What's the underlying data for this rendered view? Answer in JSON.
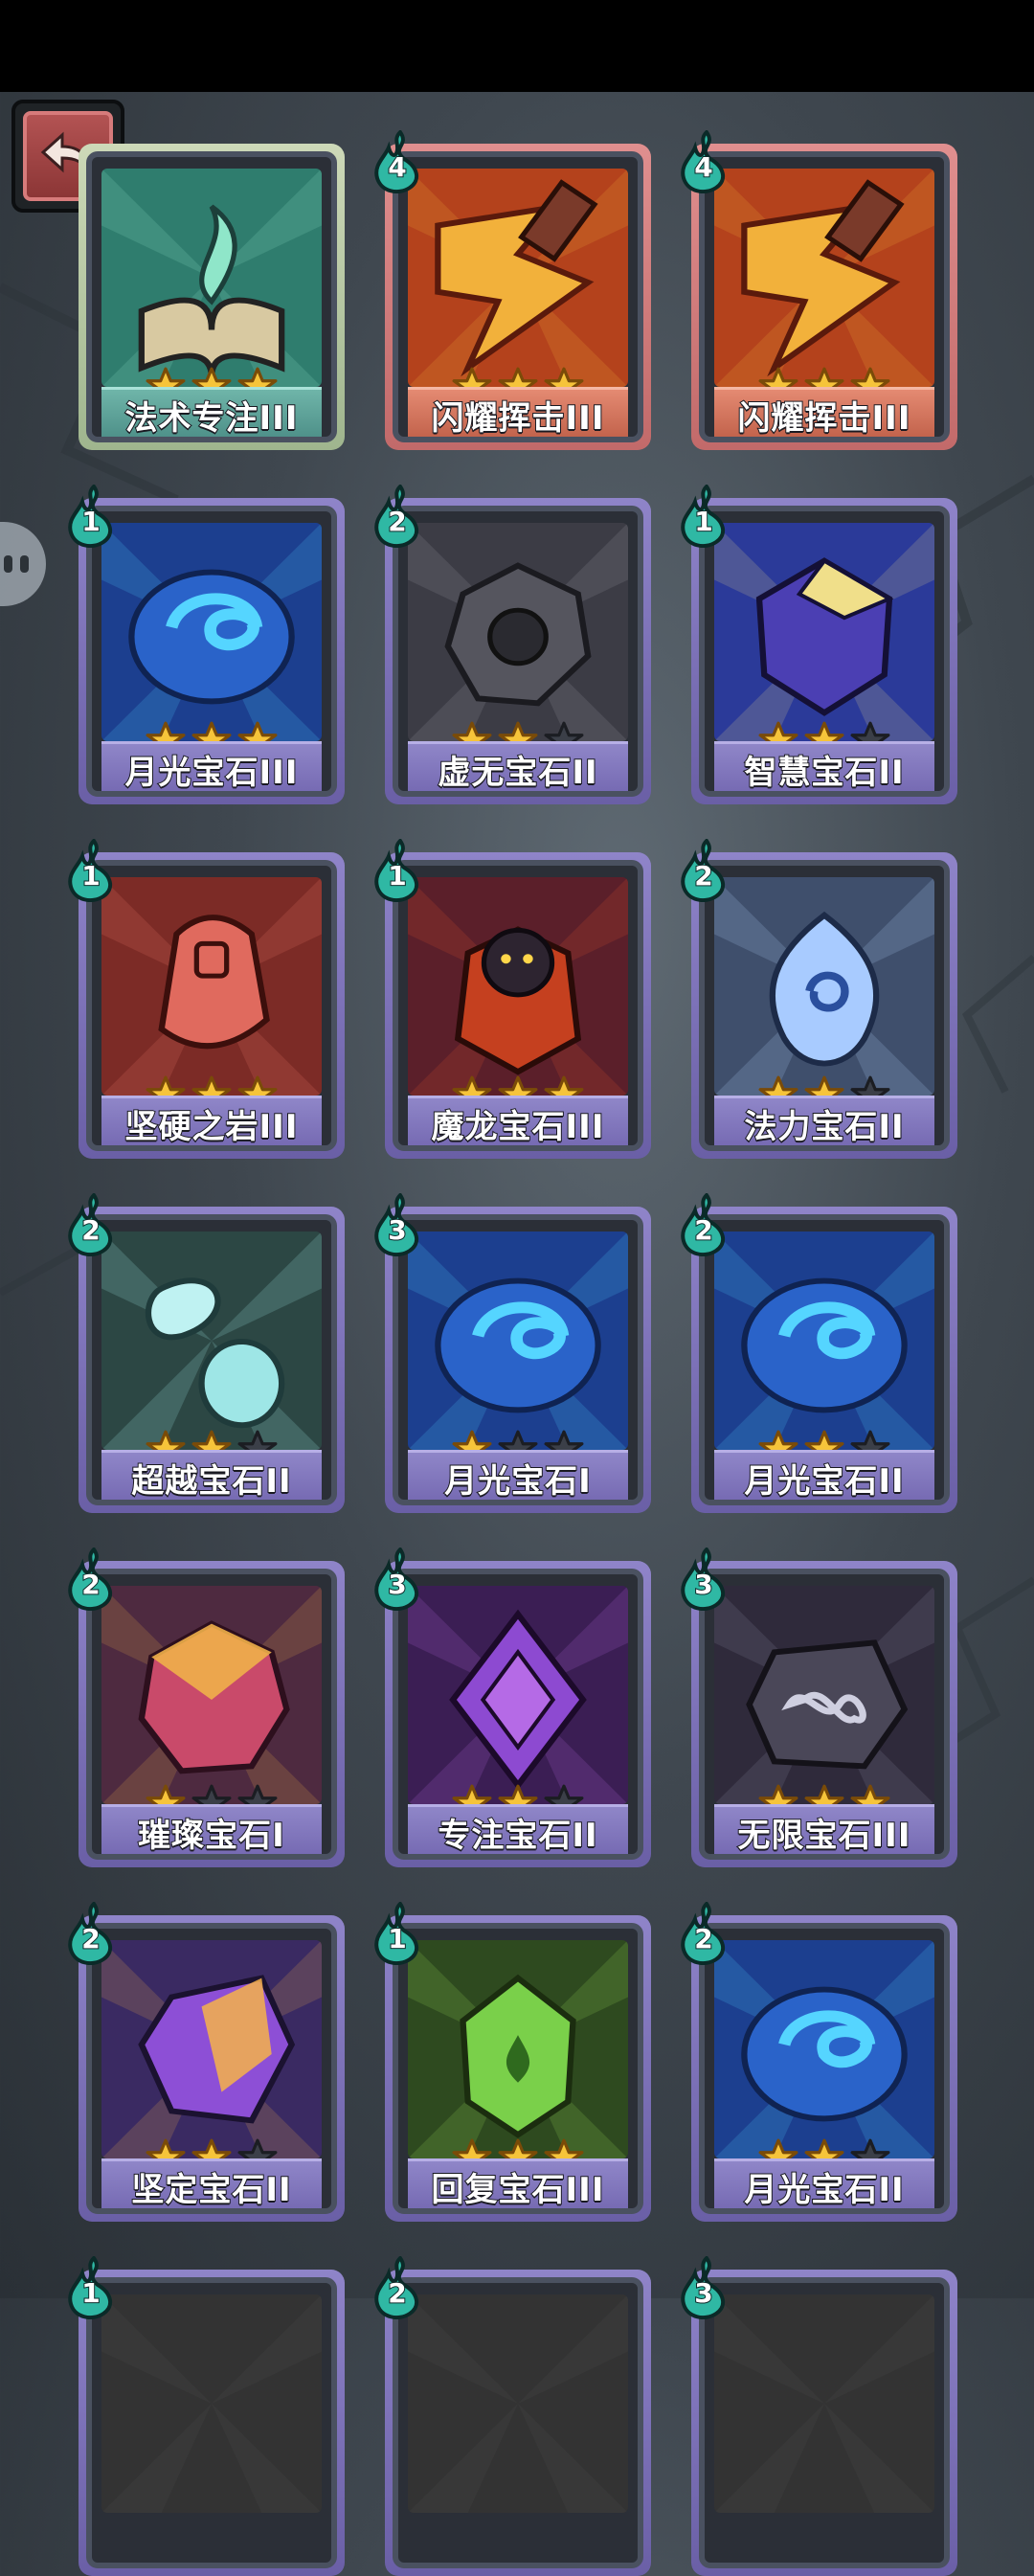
{
  "ui": {
    "back_icon": "back-arrow-icon"
  },
  "cards": [
    {
      "name": "法术专注III",
      "stars": 3,
      "cost": null,
      "frame": "green",
      "art": "book",
      "colors": [
        "#2f7d6e",
        "#8fe6c9"
      ]
    },
    {
      "name": "闪耀挥击III",
      "stars": 3,
      "cost": "4",
      "frame": "red",
      "art": "slash",
      "colors": [
        "#b4421c",
        "#f2b13b"
      ]
    },
    {
      "name": "闪耀挥击III",
      "stars": 3,
      "cost": "4",
      "frame": "red",
      "art": "slash",
      "colors": [
        "#b4421c",
        "#f2b13b"
      ]
    },
    {
      "name": "月光宝石III",
      "stars": 3,
      "cost": "1",
      "frame": "gem",
      "art": "moon",
      "colors": [
        "#1c3f8f",
        "#55d5ff"
      ]
    },
    {
      "name": "虚无宝石II",
      "stars": 2,
      "cost": "2",
      "frame": "gem",
      "art": "void",
      "colors": [
        "#3c3c45",
        "#9a9aa6"
      ]
    },
    {
      "name": "智慧宝石II",
      "stars": 2,
      "cost": "1",
      "frame": "gem",
      "art": "wisdom",
      "colors": [
        "#2b3a99",
        "#f0df8a"
      ]
    },
    {
      "name": "坚硬之岩III",
      "stars": 3,
      "cost": "1",
      "frame": "gem",
      "art": "rock",
      "colors": [
        "#7c2b26",
        "#f07a6a"
      ]
    },
    {
      "name": "魔龙宝石III",
      "stars": 3,
      "cost": "1",
      "frame": "gem",
      "art": "dragon",
      "colors": [
        "#5b1f2a",
        "#e0552c"
      ]
    },
    {
      "name": "法力宝石II",
      "stars": 2,
      "cost": "2",
      "frame": "gem",
      "art": "mana",
      "colors": [
        "#3f4f6c",
        "#b9d7ff"
      ]
    },
    {
      "name": "超越宝石II",
      "stars": 2,
      "cost": "2",
      "frame": "gem",
      "art": "beyond",
      "colors": [
        "#2c4744",
        "#a9f2f2"
      ]
    },
    {
      "name": "月光宝石I",
      "stars": 1,
      "cost": "3",
      "frame": "gem",
      "art": "moon",
      "colors": [
        "#1c3f8f",
        "#55d5ff"
      ]
    },
    {
      "name": "月光宝石II",
      "stars": 2,
      "cost": "2",
      "frame": "gem",
      "art": "moon",
      "colors": [
        "#1c3f8f",
        "#55d5ff"
      ]
    },
    {
      "name": "璀璨宝石I",
      "stars": 1,
      "cost": "2",
      "frame": "gem",
      "art": "brilliant",
      "colors": [
        "#4e2a40",
        "#f0b04a"
      ]
    },
    {
      "name": "专注宝石II",
      "stars": 2,
      "cost": "3",
      "frame": "gem",
      "art": "focus",
      "colors": [
        "#3b1e54",
        "#b56ae6"
      ]
    },
    {
      "name": "无限宝石III",
      "stars": 3,
      "cost": "3",
      "frame": "gem",
      "art": "infinity",
      "colors": [
        "#2f2a3b",
        "#8a8aa0"
      ]
    },
    {
      "name": "坚定宝石II",
      "stars": 2,
      "cost": "2",
      "frame": "gem",
      "art": "firm",
      "colors": [
        "#3a2a62",
        "#f6b24a"
      ]
    },
    {
      "name": "回复宝石III",
      "stars": 3,
      "cost": "1",
      "frame": "gem",
      "art": "heal",
      "colors": [
        "#2e4a1f",
        "#9be05a"
      ]
    },
    {
      "name": "月光宝石II",
      "stars": 2,
      "cost": "2",
      "frame": "gem",
      "art": "moon",
      "colors": [
        "#1c3f8f",
        "#55d5ff"
      ]
    },
    {
      "name": "",
      "stars": 0,
      "cost": "1",
      "frame": "gem",
      "art": "none",
      "colors": [
        "#333",
        "#555"
      ]
    },
    {
      "name": "",
      "stars": 0,
      "cost": "2",
      "frame": "gem",
      "art": "none",
      "colors": [
        "#333",
        "#555"
      ]
    },
    {
      "name": "",
      "stars": 0,
      "cost": "3",
      "frame": "gem",
      "art": "none",
      "colors": [
        "#333",
        "#555"
      ]
    }
  ]
}
